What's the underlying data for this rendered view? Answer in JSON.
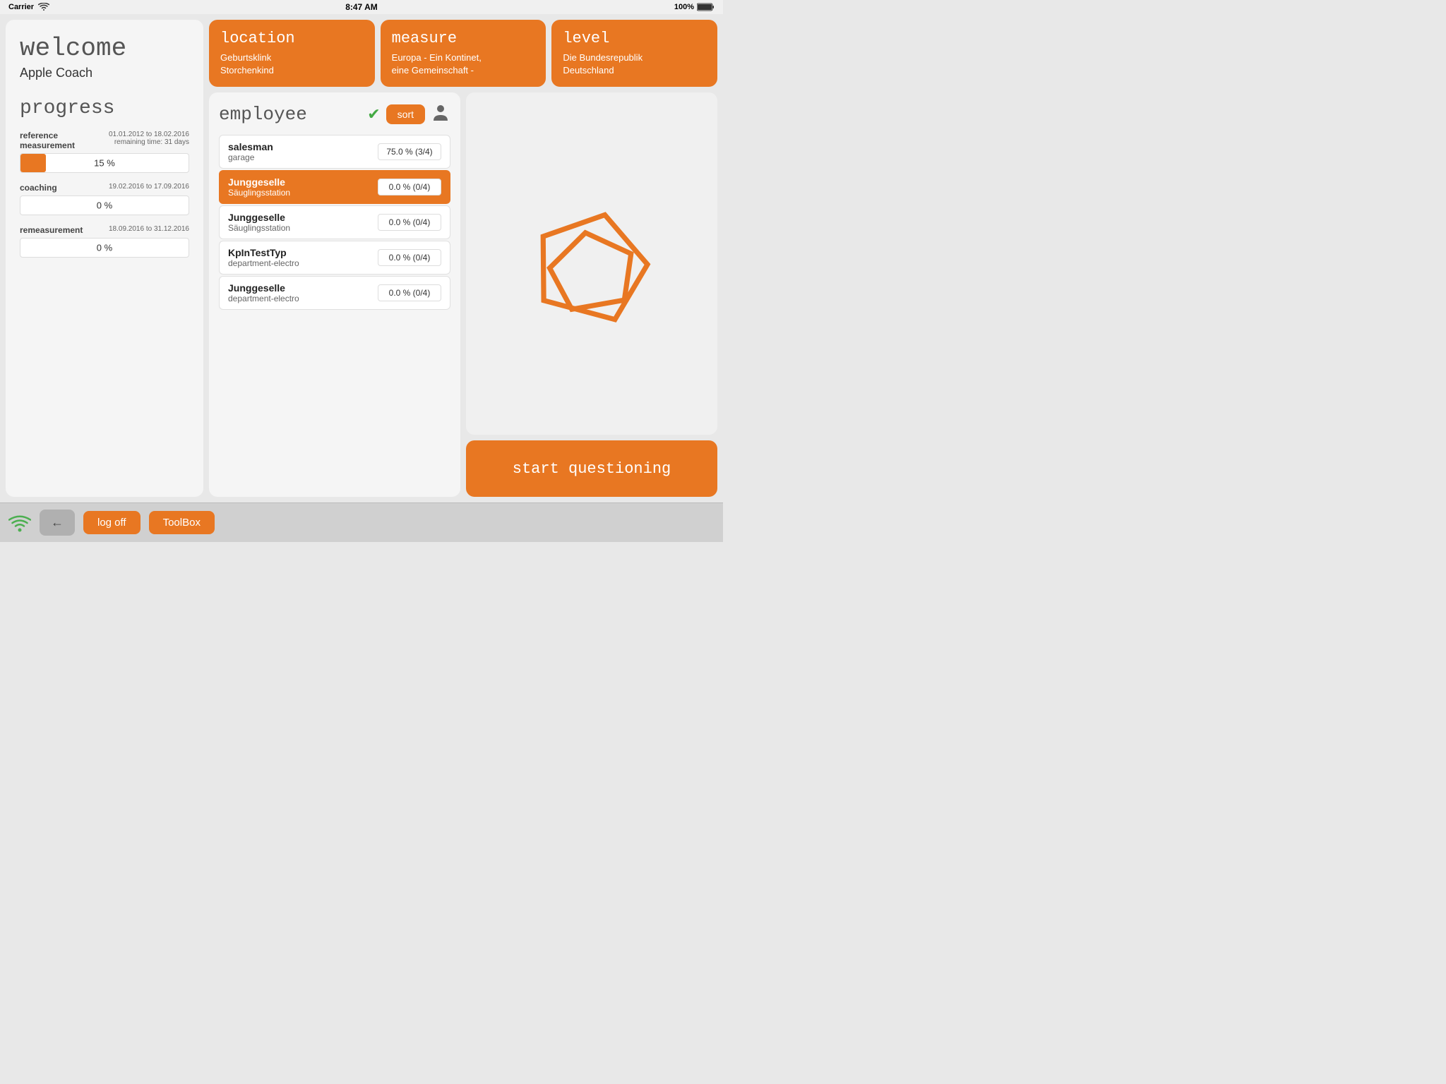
{
  "statusBar": {
    "carrier": "Carrier",
    "time": "8:47 AM",
    "battery": "100%"
  },
  "welcome": {
    "title": "welcome",
    "name": "Apple Coach"
  },
  "progress": {
    "sectionTitle": "progress",
    "items": [
      {
        "label": "reference\nmeasurement",
        "dateRange": "01.01.2012 to 18.02.2016",
        "remaining": "remaining time: 31 days",
        "percent": 15,
        "percentLabel": "15 %"
      },
      {
        "label": "coaching",
        "dateRange": "19.02.2016 to 17.09.2016",
        "remaining": "",
        "percent": 0,
        "percentLabel": "0 %"
      },
      {
        "label": "remeasurement",
        "dateRange": "18.09.2016 to 31.12.2016",
        "remaining": "",
        "percent": 0,
        "percentLabel": "0 %"
      }
    ]
  },
  "topCards": [
    {
      "title": "location",
      "content": "Geburtsklink\nStorchenkind"
    },
    {
      "title": "measure",
      "content": "Europa - Ein Kontinet,\neine Gemeinschaft -"
    },
    {
      "title": "level",
      "content": "Die Bundesrepublik\nDeutschland"
    }
  ],
  "employee": {
    "title": "employee",
    "sortLabel": "sort",
    "rows": [
      {
        "name": "salesman",
        "dept": "garage",
        "score": "75.0 % (3/4)",
        "highlighted": false
      },
      {
        "name": "Junggeselle",
        "dept": "Säuglingsstation",
        "score": "0.0 % (0/4)",
        "highlighted": true
      },
      {
        "name": "Junggeselle",
        "dept": "Säuglingsstation",
        "score": "0.0 % (0/4)",
        "highlighted": false
      },
      {
        "name": "KpInTestTyp",
        "dept": "department-electro",
        "score": "0.0 % (0/4)",
        "highlighted": false
      },
      {
        "name": "Junggeselle",
        "dept": "department-electro",
        "score": "0.0 % (0/4)",
        "highlighted": false
      }
    ]
  },
  "startQuestioning": {
    "label": "start questioning"
  },
  "bottomBar": {
    "logOffLabel": "log off",
    "toolboxLabel": "ToolBox"
  }
}
